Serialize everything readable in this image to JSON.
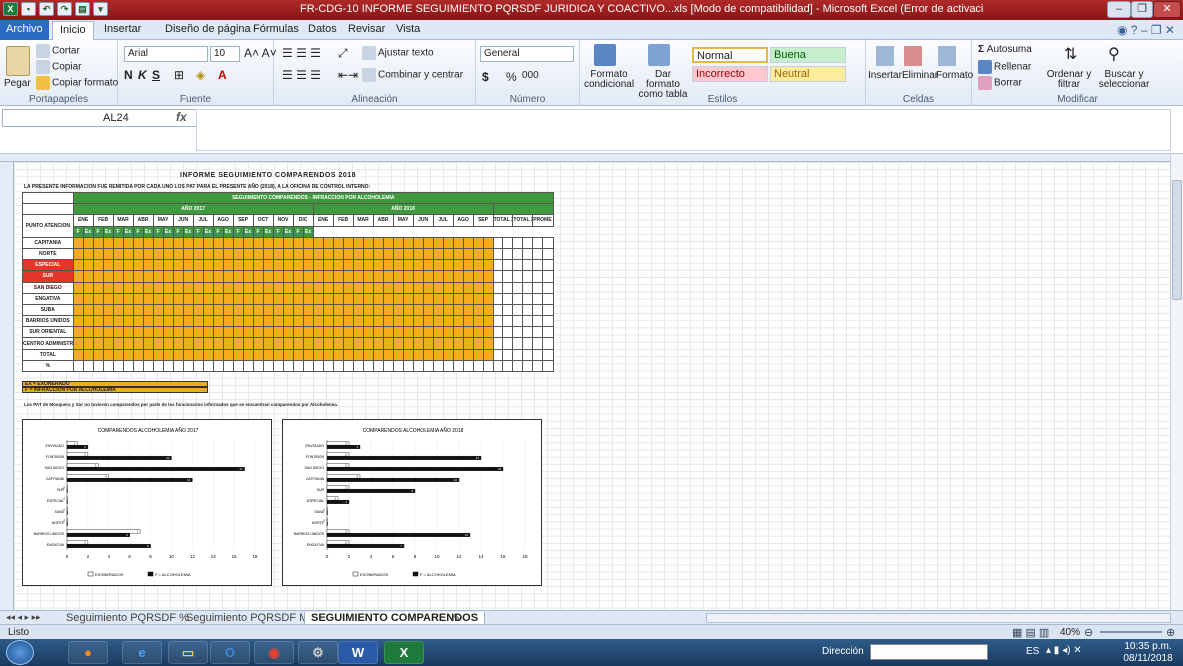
{
  "window": {
    "title": "FR-CDG-10 INFORME SEGUIMIENTO PQRSDF JURIDICA Y COACTIVO...xls [Modo de compatibilidad] - Microsoft Excel (Error de activación de productos)"
  },
  "tabs": [
    "Archivo",
    "Inicio",
    "Insertar",
    "Diseño de página",
    "Fórmulas",
    "Datos",
    "Revisar",
    "Vista"
  ],
  "ribbon": {
    "clipboard": {
      "label": "Portapapeles",
      "paste": "Pegar",
      "cut": "Cortar",
      "copy": "Copiar",
      "format": "Copiar formato"
    },
    "font": {
      "label": "Fuente",
      "name": "Arial",
      "size": "10",
      "bold": "N",
      "italic": "K",
      "underline": "S"
    },
    "align": {
      "label": "Alineación",
      "wrap": "Ajustar texto",
      "merge": "Combinar y centrar"
    },
    "number": {
      "label": "Número",
      "format": "General",
      "currency": "$",
      "percent": "%",
      "thousands": "000"
    },
    "styles": {
      "label": "Estilos",
      "cond": "Formato condicional",
      "table": "Dar formato como tabla",
      "normal": "Normal",
      "buena": "Buena",
      "incorrecto": "Incorrecto",
      "neutral": "Neutral"
    },
    "cells": {
      "label": "Celdas",
      "insert": "Insertar",
      "delete": "Eliminar",
      "format": "Formato"
    },
    "editing": {
      "label": "Modificar",
      "autosum": "Autosuma",
      "fill": "Rellenar",
      "clear": "Borrar",
      "sort": "Ordenar y filtrar",
      "find": "Buscar y seleccionar"
    }
  },
  "formula": {
    "namebox": "AL24",
    "fx": "fx"
  },
  "sheet": {
    "title": "INFORME SEGUIMIENTO COMPARENDOS 2018",
    "intro": "LA PRESENTE INFORMACION FUE REMITIDA POR CADA UNO LOS PAT PARA EL PRESENTE AÑO (2018), A LA OFICINA DE CONTROL INTERNO:",
    "table_title": "SEGUIMIENTO COMPARENDOS - INFRACCION POR ALCOHOLEMIA",
    "year1": "AÑO 2017",
    "year2": "AÑO 2018",
    "punto": "PUNTO ATENCION",
    "months": [
      "ENE",
      "FEB",
      "MAR",
      "ABR",
      "MAY",
      "JUN",
      "JUL",
      "AGO",
      "SEP",
      "OCT",
      "NOV",
      "DIC",
      "ENE",
      "FEB",
      "MAR",
      "ABR",
      "MAY",
      "JUN",
      "JUL",
      "AGO",
      "SEP"
    ],
    "totals": [
      "TOTAL 2017",
      "TOTAL 2018",
      "PROME DIO"
    ],
    "sub": [
      "F",
      "Ex"
    ],
    "rows": [
      "CAPITANIA",
      "NORTE",
      "ESPECIAL",
      "SUR",
      "SAN DIEGO",
      "ENGATIVA",
      "SUBA",
      "BARRIOS UNIDOS",
      "SUR ORIENTAL",
      "CENTRO ADMINISTRATIVO",
      "TOTAL",
      "%"
    ],
    "legend1": "EX = EXONERADO",
    "legend2": "F = INFRACCION POR ALCOHOLEMIA",
    "note": "Los PAT de Mosquera y Sur no tuvieron comparendos por parte de los funcionarios informados que se encuentran comparendos por Alcoholemia."
  },
  "charts": [
    {
      "title": "COMPARENDOS ALCOHOLEMIA AÑO 2017",
      "legend": [
        "EXONERADOS",
        "F = ALCOHOLEMIA"
      ]
    },
    {
      "title": "COMPARENDOS ALCOHOLEMIA AÑO 2018",
      "legend": [
        "EXONERADOS",
        "F = ALCOHOLEMIA"
      ]
    }
  ],
  "chart_data": [
    {
      "type": "bar",
      "title": "COMPARENDOS ALCOHOLEMIA AÑO 2017",
      "categories": [
        "ENVIGADO",
        "FONTIBON",
        "SAN DIEGO",
        "CAPITANIA",
        "SUR",
        "ESPECIAL",
        "SUBA",
        "NORTE",
        "BARRIOS UNIDOS",
        "ENGATIVA"
      ],
      "series": [
        {
          "name": "EXONERADOS",
          "values": [
            1,
            2,
            3,
            4,
            0,
            0,
            0,
            0,
            7,
            2
          ]
        },
        {
          "name": "F = ALCOHOLEMIA",
          "values": [
            2,
            10,
            17,
            12,
            0,
            0,
            0,
            0,
            6,
            8
          ]
        }
      ],
      "xlim": [
        0,
        18
      ]
    },
    {
      "type": "bar",
      "title": "COMPARENDOS ALCOHOLEMIA AÑO 2018",
      "categories": [
        "ENVIGADO",
        "FONTIBON",
        "SAN DIEGO",
        "CAPITANIA",
        "SUR",
        "ESPECIAL",
        "SUBA",
        "NORTE",
        "BARRIOS UNIDOS",
        "ENGATIVA"
      ],
      "series": [
        {
          "name": "EXONERADOS",
          "values": [
            2,
            2,
            2,
            3,
            2,
            1,
            0,
            0,
            2,
            2
          ]
        },
        {
          "name": "F = ALCOHOLEMIA",
          "values": [
            3,
            14,
            16,
            12,
            8,
            2,
            0,
            0,
            13,
            7
          ]
        }
      ],
      "xlim": [
        0,
        18
      ]
    }
  ],
  "sheettabs": [
    "Seguimiento PQRSDF %",
    "Seguimiento PQRSDF Mes",
    "SEGUIMIENTO COMPARENDOS"
  ],
  "status": {
    "ready": "Listo",
    "zoom": "40%"
  },
  "taskbar": {
    "address": "Dirección",
    "lang": "ES",
    "time": "10:35 p.m.",
    "date": "08/11/2018"
  },
  "colors": {
    "excel_green": "#1e7a3a",
    "title_red": "#a91d1d",
    "table_yellow": "#f3ad1c",
    "table_green": "#3f9a3f"
  }
}
